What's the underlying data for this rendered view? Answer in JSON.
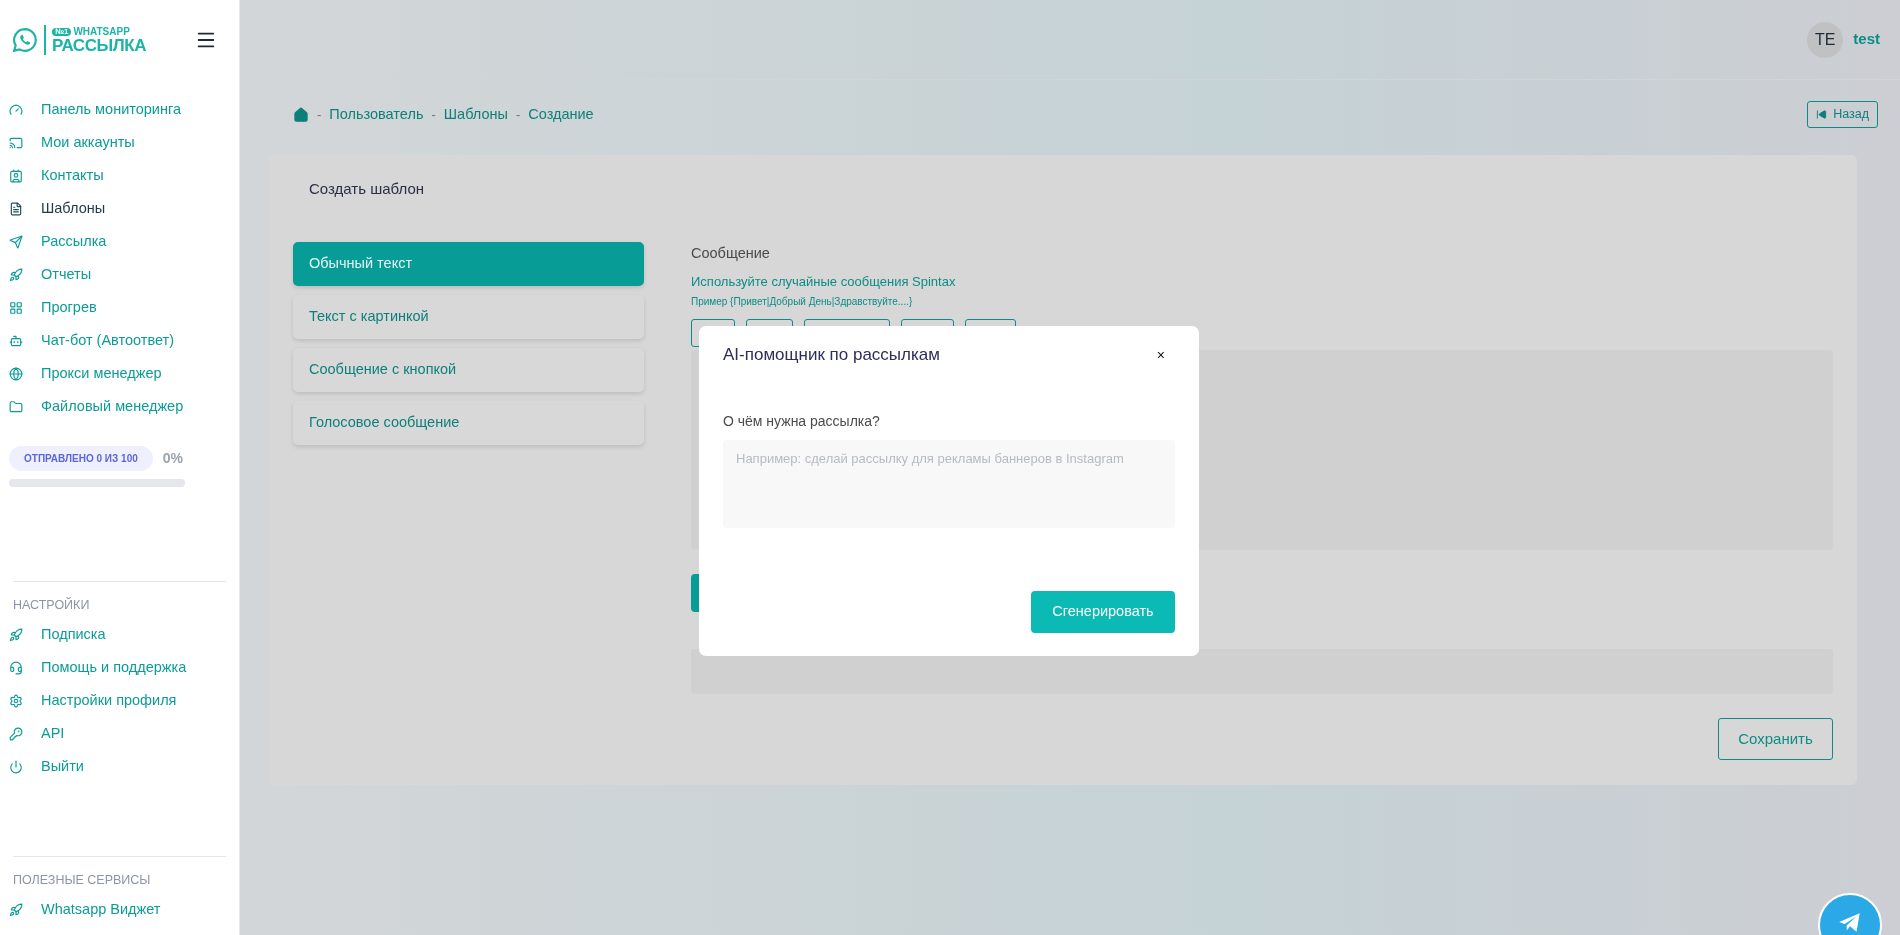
{
  "logo": {
    "badge": "№1",
    "line1": "WHATSAPP",
    "line2": "РАССЫЛКА"
  },
  "sidebar": {
    "items": [
      {
        "label": "Панель мониторинга",
        "selected": false
      },
      {
        "label": "Мои аккаунты",
        "selected": false
      },
      {
        "label": "Контакты",
        "selected": false
      },
      {
        "label": "Шаблоны",
        "selected": true
      },
      {
        "label": "Рассылка",
        "selected": false
      },
      {
        "label": "Отчеты",
        "selected": false
      },
      {
        "label": "Прогрев",
        "selected": false
      },
      {
        "label": "Чат-бот (Автоответ)",
        "selected": false
      },
      {
        "label": "Прокси менеджер",
        "selected": false
      },
      {
        "label": "Файловый менеджер",
        "selected": false
      }
    ],
    "quota": {
      "badge": "ОТПРАВЛЕНО 0 ИЗ 100",
      "percent": "0%",
      "level": 0
    },
    "settings_title": "НАСТРОЙКИ",
    "settings_items": [
      {
        "label": "Подписка"
      },
      {
        "label": "Помощь и поддержка"
      },
      {
        "label": "Настройки профиля"
      },
      {
        "label": "API"
      },
      {
        "label": "Выйти"
      }
    ],
    "services_title": "ПОЛЕЗНЫЕ СЕРВИСЫ",
    "services_items": [
      {
        "label": "Whatsapp Виджет"
      }
    ]
  },
  "user": {
    "initials": "TE",
    "name": "test"
  },
  "breadcrumb": [
    {
      "separator": "-",
      "label": "Пользователь"
    },
    {
      "separator": "-",
      "label": "Шаблоны"
    },
    {
      "separator": "-",
      "label": "Создание"
    }
  ],
  "back_button": "Назад",
  "card": {
    "title": "Создать шаблон",
    "tabs": [
      {
        "label": "Обычный текст",
        "selected": true
      },
      {
        "label": "Текст с картинкой",
        "selected": false
      },
      {
        "label": "Сообщение с кнопкой",
        "selected": false
      },
      {
        "label": "Голосовое сообщение",
        "selected": false
      }
    ],
    "message_label": "Сообщение",
    "spintax_hint": "Используйте случайные сообщения Spintax",
    "spintax_example": "Пример {Привет|Добрый День|Здравствуйте....}",
    "save_button": "Сохранить"
  },
  "modal": {
    "title": "AI-помощник по рассылкам",
    "close": "×",
    "question": "О чём нужна рассылка?",
    "placeholder": "Например: сделай рассылку для рекламы баннеров в Instagram",
    "submit": "Сгенерировать"
  }
}
